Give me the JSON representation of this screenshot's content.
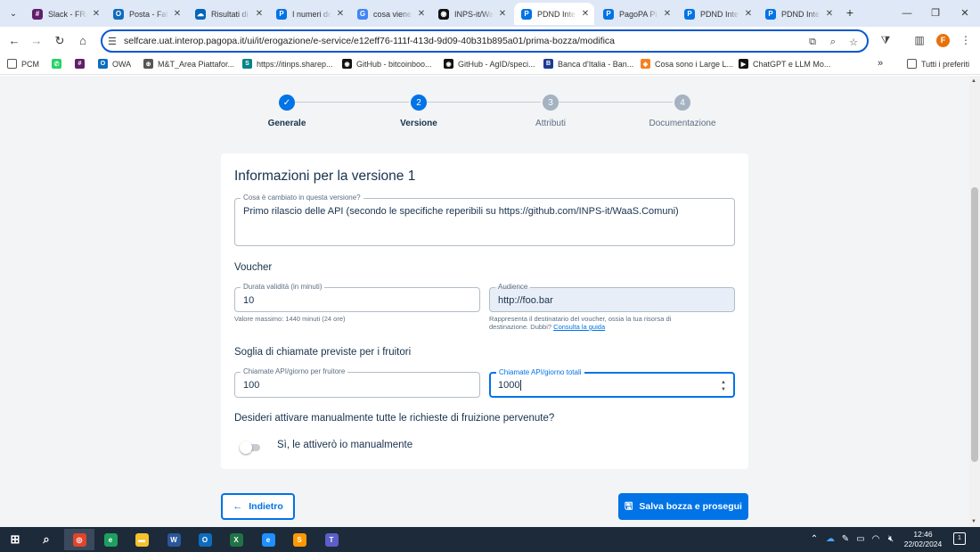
{
  "browser": {
    "tabs": [
      {
        "title": "Slack - FRA",
        "icon": "slack-icon",
        "color": "#611f69",
        "active": false
      },
      {
        "title": "Posta - Fab",
        "icon": "outlook-icon",
        "color": "#0f6cbd",
        "active": false
      },
      {
        "title": "Risultati di",
        "icon": "onedrive-icon",
        "color": "#0364b8",
        "active": false
      },
      {
        "title": "I numeri de",
        "icon": "pagopa-icon",
        "color": "#0073e6",
        "active": false
      },
      {
        "title": "cosa viene",
        "icon": "google-icon",
        "color": "#4285f4",
        "active": false
      },
      {
        "title": "INPS-it/Wa",
        "icon": "github-icon",
        "color": "#111111",
        "active": false
      },
      {
        "title": "PDND Inte",
        "icon": "pagopa-icon",
        "color": "#0073e6",
        "active": true
      },
      {
        "title": "PagoPA Pi",
        "icon": "pagopa-icon",
        "color": "#0073e6",
        "active": false
      },
      {
        "title": "PDND Inte",
        "icon": "pagopa-icon",
        "color": "#0073e6",
        "active": false
      },
      {
        "title": "PDND Inte",
        "icon": "pagopa-icon",
        "color": "#0073e6",
        "active": false
      }
    ],
    "url": "selfcare.uat.interop.pagopa.it/ui/it/erogazione/e-service/e12eff76-111f-413d-9d09-40b31b895a01/prima-bozza/modifica",
    "profile_initial": "F",
    "bookmarks": [
      {
        "label": "PCM",
        "icon": "folder-icon",
        "color": "#555555"
      },
      {
        "label": "",
        "icon": "whatsapp-icon",
        "color": "#25d366"
      },
      {
        "label": "",
        "icon": "slack-icon",
        "color": "#611f69"
      },
      {
        "label": "OWA",
        "icon": "outlook-icon",
        "color": "#0f6cbd"
      },
      {
        "label": "M&T_Area Piattafor...",
        "icon": "globe-icon",
        "color": "#555555"
      },
      {
        "label": "https://itinps.sharep...",
        "icon": "sharepoint-icon",
        "color": "#038387"
      },
      {
        "label": "GitHub - bitcoinboo...",
        "icon": "github-icon",
        "color": "#111111"
      },
      {
        "label": "GitHub - AgID/speci...",
        "icon": "github-icon",
        "color": "#111111"
      },
      {
        "label": "Banca d'Italia - Ban...",
        "icon": "bankitalia-icon",
        "color": "#1f3a93"
      },
      {
        "label": "Cosa sono i Large L...",
        "icon": "aws-icon",
        "color": "#f58220"
      },
      {
        "label": "ChatGPT e LLM Mo...",
        "icon": "video-icon",
        "color": "#111111"
      }
    ],
    "more_bookmarks": "»",
    "all_bookmarks": "Tutti i preferiti"
  },
  "stepper": [
    {
      "number": "✓",
      "label": "Generale",
      "state": "done",
      "color": "#0073e6"
    },
    {
      "number": "2",
      "label": "Versione",
      "state": "current",
      "color": "#0073e6"
    },
    {
      "number": "3",
      "label": "Attributi",
      "state": "todo",
      "color": "#a4b2c1"
    },
    {
      "number": "4",
      "label": "Documentazione",
      "state": "todo",
      "color": "#a4b2c1"
    }
  ],
  "form": {
    "title": "Informazioni per la versione 1",
    "description_label": "Cosa è cambiato in questa versione?",
    "description_value": "Primo rilascio delle API (secondo le specifiche reperibili su https://github.com/INPS-it/WaaS.Comuni)",
    "voucher_heading": "Voucher",
    "duration_label": "Durata validità (in minuti)",
    "duration_value": "10",
    "duration_helper": "Valore massimo: 1440 minuti (24 ore)",
    "audience_label": "Audience",
    "audience_value": "http://foo.bar",
    "audience_helper": "Rappresenta il destinatario del voucher, ossia la tua risorsa di destinazione. Dubbi?",
    "audience_link": "Consulta la guida",
    "threshold_heading": "Soglia di chiamate previste per i fruitori",
    "per_consumer_label": "Chiamate API/giorno per fruitore",
    "per_consumer_value": "100",
    "total_label": "Chiamate API/giorno totali",
    "total_value": "1000",
    "manual_question": "Desideri attivare manualmente tutte le richieste di fruizione pervenute?",
    "manual_toggle_label": "Sì, le attiverò io manualmente",
    "manual_toggle_on": false
  },
  "actions": {
    "back_label": "Indietro",
    "save_label": "Salva bozza e prosegui"
  },
  "taskbar": {
    "apps": [
      {
        "icon": "windows-start-icon",
        "color": "#ffffff"
      },
      {
        "icon": "search-icon",
        "color": "#ffffff"
      },
      {
        "icon": "chrome-icon",
        "color": "#e0452c"
      },
      {
        "icon": "edge-icon",
        "color": "#1d9f5f"
      },
      {
        "icon": "file-explorer-icon",
        "color": "#f5c12e"
      },
      {
        "icon": "word-icon",
        "color": "#2b579a"
      },
      {
        "icon": "outlook-icon",
        "color": "#0f6cbd"
      },
      {
        "icon": "excel-icon",
        "color": "#217346"
      },
      {
        "icon": "internet-explorer-icon",
        "color": "#1e90ff"
      },
      {
        "icon": "sublime-icon",
        "color": "#ff9800"
      },
      {
        "icon": "teams-icon",
        "color": "#5b5fc7"
      }
    ],
    "time": "12:46",
    "date": "22/02/2024",
    "notification_count": "1"
  }
}
